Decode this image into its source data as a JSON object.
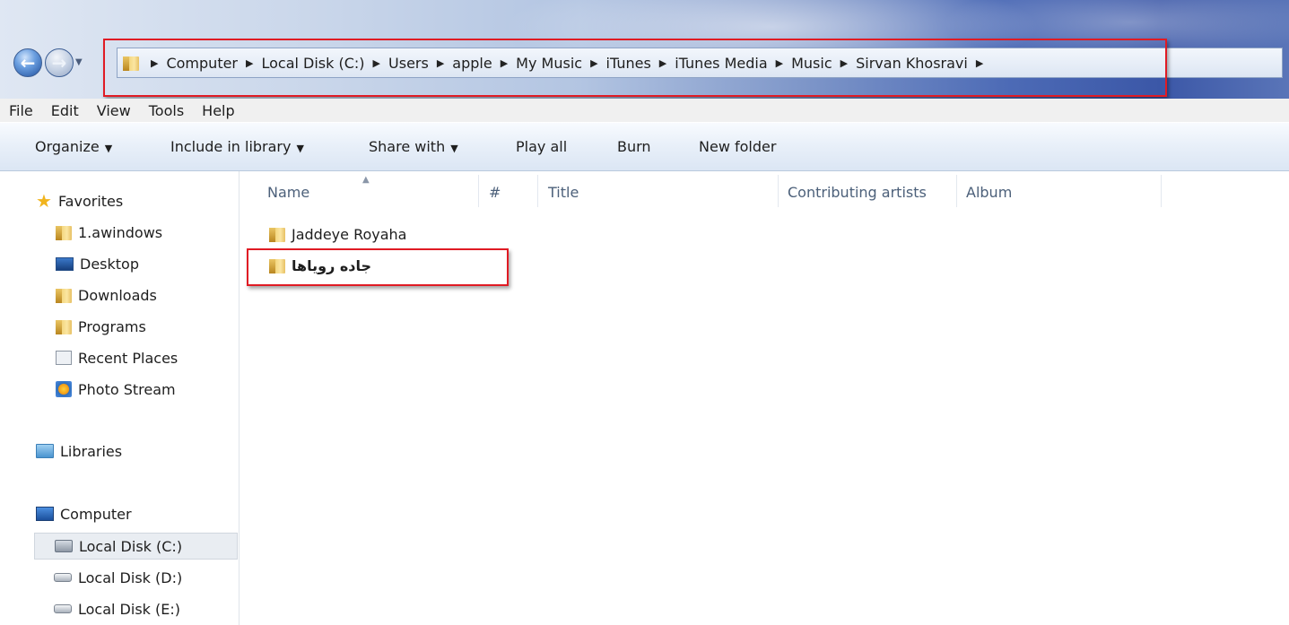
{
  "address_bar": {
    "crumbs": [
      "Computer",
      "Local Disk (C:)",
      "Users",
      "apple",
      "My Music",
      "iTunes",
      "iTunes Media",
      "Music",
      "Sirvan Khosravi"
    ]
  },
  "menu": [
    "File",
    "Edit",
    "View",
    "Tools",
    "Help"
  ],
  "toolbar": {
    "organize": "Organize",
    "include_in_library": "Include in library",
    "share_with": "Share with",
    "play_all": "Play all",
    "burn": "Burn",
    "new_folder": "New folder"
  },
  "navigation": {
    "favorites_label": "Favorites",
    "favorites": [
      "1.awindows",
      "Desktop",
      "Downloads",
      "Programs",
      "Recent Places",
      "Photo Stream"
    ],
    "libraries_label": "Libraries",
    "computer_label": "Computer",
    "drives": [
      "Local Disk (C:)",
      "Local Disk (D:)",
      "Local Disk (E:)"
    ],
    "selected_drive": "Local Disk (C:)"
  },
  "columns": [
    "Name",
    "#",
    "Title",
    "Contributing artists",
    "Album"
  ],
  "files": [
    "Jaddeye Royaha",
    "جاده رویاها"
  ],
  "colors": {
    "highlight_box": "#e01b24",
    "selection_bg": "#e9edf2",
    "toolbar_gradient_top": "#f8fbff",
    "toolbar_gradient_bottom": "#dbe6f4"
  }
}
